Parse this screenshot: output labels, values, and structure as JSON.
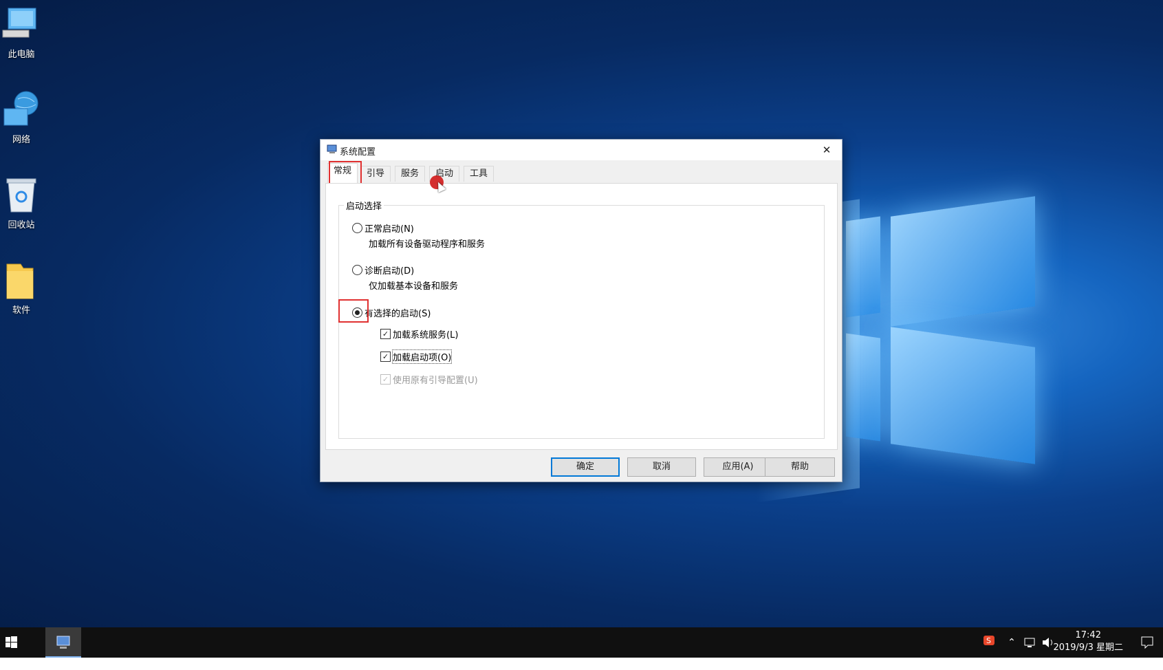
{
  "desktop": {
    "icons": [
      {
        "label": "此电脑"
      },
      {
        "label": "网络"
      },
      {
        "label": "回收站"
      },
      {
        "label": "软件"
      }
    ]
  },
  "window": {
    "title": "系统配置",
    "close_glyph": "✕",
    "tabs": [
      {
        "label": "常规",
        "active": true
      },
      {
        "label": "引导"
      },
      {
        "label": "服务"
      },
      {
        "label": "启动"
      },
      {
        "label": "工具"
      }
    ],
    "group_label": "启动选择",
    "options": [
      {
        "label": "正常启动(N)",
        "desc": "加载所有设备驱动程序和服务",
        "selected": false
      },
      {
        "label": "诊断启动(D)",
        "desc": "仅加载基本设备和服务",
        "selected": false
      },
      {
        "label": "有选择的启动(S)",
        "selected": true
      }
    ],
    "checkboxes": [
      {
        "label": "加载系统服务(L)",
        "checked": true,
        "enabled": true
      },
      {
        "label": "加载启动项(O)",
        "checked": true,
        "enabled": true
      },
      {
        "label": "使用原有引导配置(U)",
        "checked": true,
        "enabled": false
      }
    ],
    "buttons": {
      "ok": "确定",
      "cancel": "取消",
      "apply": "应用(A)",
      "help": "帮助"
    }
  },
  "taskbar": {
    "time": "17:42",
    "date": "2019/9/3 星期二",
    "tray_icons": [
      "sogou-ime-icon",
      "chevron-up-icon",
      "network-icon",
      "volume-icon",
      "notification-icon"
    ]
  },
  "colors": {
    "highlight": "#e03030",
    "accent": "#0078d7"
  }
}
